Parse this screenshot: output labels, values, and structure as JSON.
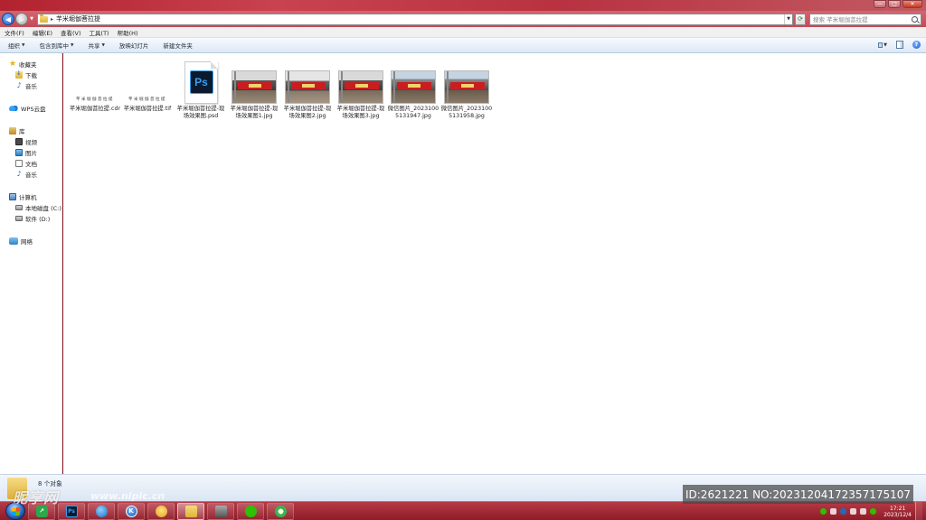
{
  "window": {
    "controls": [
      "—",
      "□",
      "✕"
    ]
  },
  "address_bar": {
    "path": "芊米堀伽菩拉提",
    "search_placeholder": "搜索 芊米堀伽菩拉提"
  },
  "menu": {
    "items": [
      "文件(F)",
      "编辑(E)",
      "查看(V)",
      "工具(T)",
      "帮助(H)"
    ]
  },
  "command_bar": {
    "items": [
      {
        "label": "组织",
        "has_dropdown": true
      },
      {
        "label": "包含到库中",
        "has_dropdown": true
      },
      {
        "label": "共享",
        "has_dropdown": true
      },
      {
        "label": "放映幻灯片",
        "has_dropdown": false
      },
      {
        "label": "新建文件夹",
        "has_dropdown": false
      }
    ]
  },
  "nav_pane": {
    "favorites": {
      "label": "收藏夹",
      "items": [
        "下载",
        "音乐"
      ]
    },
    "cloud": {
      "label": "WPS云盘"
    },
    "libraries": {
      "label": "库",
      "items": [
        "视频",
        "图片",
        "文档",
        "音乐"
      ]
    },
    "computer": {
      "label": "计算机",
      "items": [
        "本地磁盘 (C:)",
        "软件 (D:)"
      ]
    },
    "network": {
      "label": "网络"
    }
  },
  "files": [
    {
      "label": "芊米堀伽菩拉提.cdr",
      "kind": "cdr",
      "preview_text": "芊米堀伽菩拉提"
    },
    {
      "label": "芊米堀伽菩拉提.tif",
      "kind": "tif",
      "preview_text": "芊米堀伽菩拉提"
    },
    {
      "label": "芊米堀伽菩拉提-现场效果图.psd",
      "kind": "psd",
      "icon_text": "Ps"
    },
    {
      "label": "芊米堀伽菩拉提-现场效果图1.jpg",
      "kind": "jpg"
    },
    {
      "label": "芊米堀伽菩拉提-现场效果图2.jpg",
      "kind": "jpg"
    },
    {
      "label": "芊米堀伽菩拉提-现场效果图3.jpg",
      "kind": "jpg"
    },
    {
      "label": "微信图片_20231005131947.jpg",
      "kind": "jpg"
    },
    {
      "label": "微信图片_20231005131958.jpg",
      "kind": "jpg"
    }
  ],
  "status": {
    "count_text": "8 个对象"
  },
  "watermark": {
    "logo": "昵享网",
    "url": "www.nipic.cn",
    "id_text": "ID:2621221 NO:20231204172357175107"
  },
  "taskbar": {
    "ps_label": "Ps",
    "k_label": "K",
    "clock_time": "17:21",
    "clock_date": "2023/12/4"
  }
}
